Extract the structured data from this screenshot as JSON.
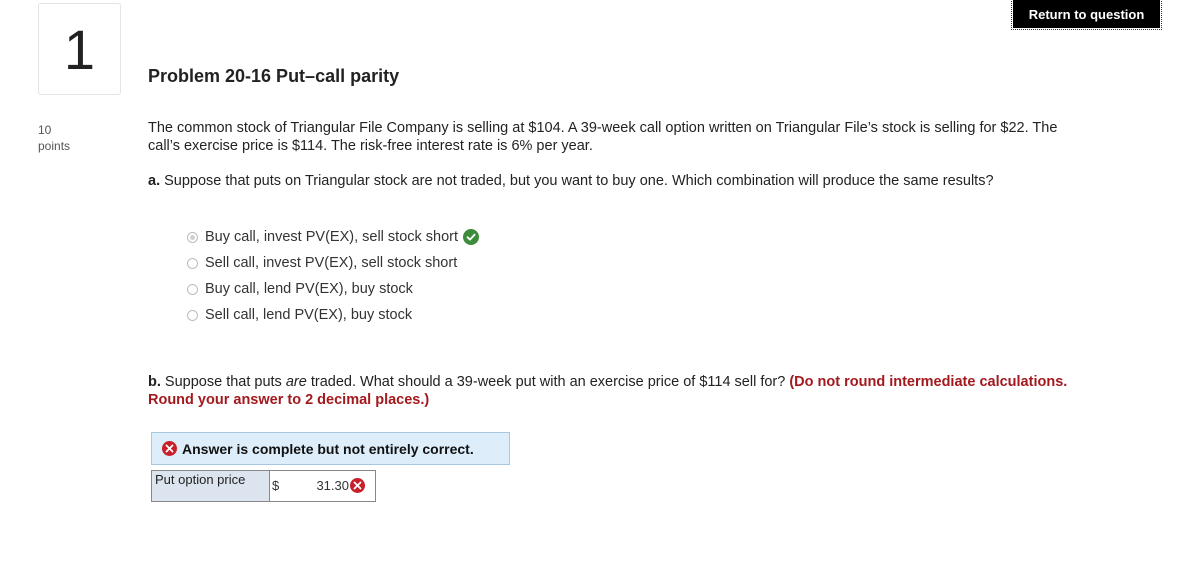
{
  "header": {
    "question_number": "1",
    "points_value": "10",
    "points_label": "points",
    "return_button": "Return to question"
  },
  "problem": {
    "title": "Problem 20-16 Put–call parity",
    "stem": "The common stock of Triangular File Company is selling at $104. A 39-week call option written on Triangular File’s stock is selling for $22. The call’s exercise price is $114. The risk-free interest rate is 6% per year."
  },
  "part_a": {
    "label": "a.",
    "question": " Suppose that puts on Triangular stock are not traded, but you want to buy one. Which combination will produce the same results?",
    "options": [
      {
        "text": "Buy call, invest PV(EX), sell stock short",
        "selected": true,
        "correct": true
      },
      {
        "text": "Sell call, invest PV(EX), sell stock short",
        "selected": false
      },
      {
        "text": "Buy call, lend PV(EX), buy stock",
        "selected": false
      },
      {
        "text": "Sell call, lend PV(EX), buy stock",
        "selected": false
      }
    ]
  },
  "part_b": {
    "label": "b.",
    "question_pre": " Suppose that puts ",
    "question_em": "are",
    "question_post": " traded. What should a 39-week put with an exercise price of $114 sell for? ",
    "instruction": "(Do not round intermediate calculations. Round your answer to 2 decimal places.)",
    "feedback": "Answer is complete but not entirely correct.",
    "answer_label": "Put option price",
    "currency": "$",
    "answer_value": "31.30"
  },
  "colors": {
    "correct_green": "#3c8c3c",
    "incorrect_red": "#c8202a",
    "instruction_red": "#a3191e",
    "feedback_bg": "#ddeefa"
  }
}
